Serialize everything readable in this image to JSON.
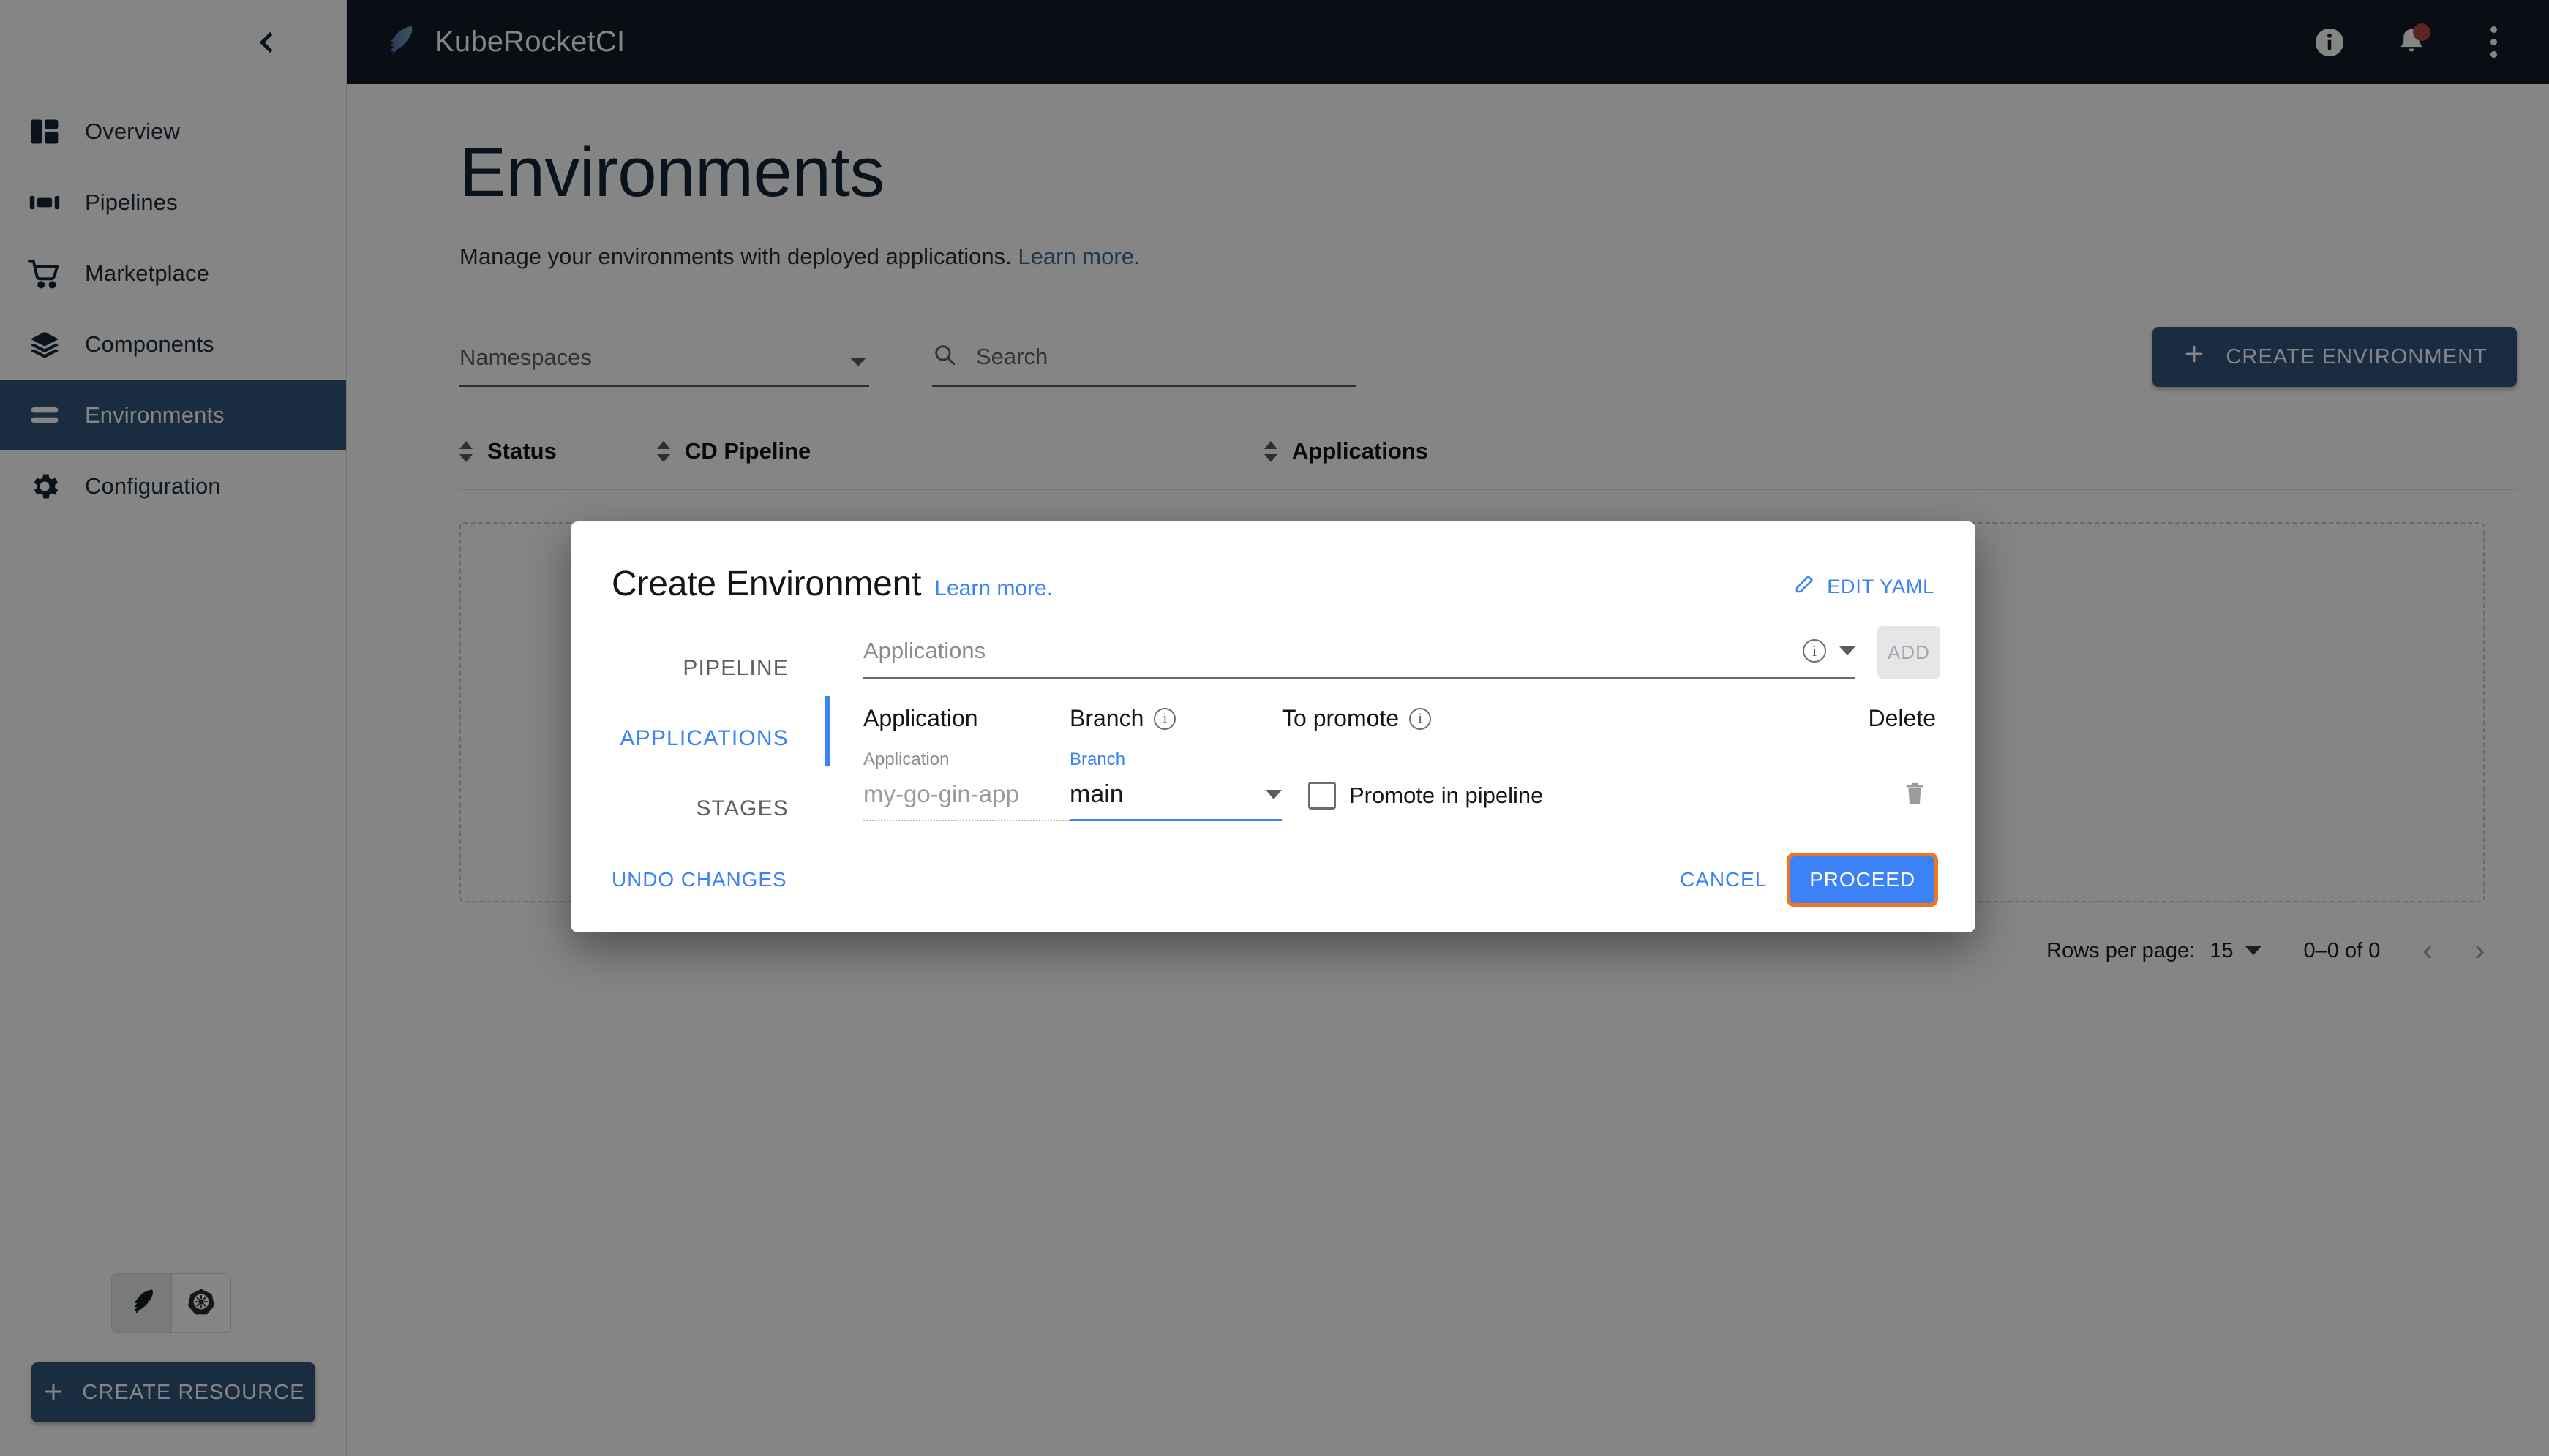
{
  "sidebar": {
    "collapse_icon": "chevron-left-icon",
    "items": [
      {
        "label": "Overview",
        "icon": "dashboard-icon",
        "active": false
      },
      {
        "label": "Pipelines",
        "icon": "pipelines-icon",
        "active": false
      },
      {
        "label": "Marketplace",
        "icon": "cart-icon",
        "active": false
      },
      {
        "label": "Components",
        "icon": "layers-icon",
        "active": false
      },
      {
        "label": "Environments",
        "icon": "environments-icon",
        "active": true
      },
      {
        "label": "Configuration",
        "icon": "gear-icon",
        "active": false
      }
    ],
    "logo_toggle": {
      "left_icon": "kuberocket-feather-icon",
      "right_icon": "kubernetes-helm-icon"
    },
    "create_resource_label": "CREATE RESOURCE",
    "create_resource_icon": "plus-icon"
  },
  "topbar": {
    "brand_name": "KubeRocketCI",
    "brand_icon": "kuberocket-feather-icon",
    "info_icon": "info-circle-icon",
    "notifications_icon": "bell-icon",
    "notifications_badge": true,
    "more_icon": "kebab-menu-icon"
  },
  "page": {
    "title": "Environments",
    "subtitle": "Manage your environments with deployed applications.",
    "subtitle_link": "Learn more."
  },
  "filters": {
    "namespaces_placeholder": "Namespaces",
    "namespaces_value": "",
    "search_placeholder": "Search",
    "search_value": "",
    "search_icon": "search-icon",
    "create_environment_label": "CREATE ENVIRONMENT",
    "create_environment_icon": "plus-icon"
  },
  "table": {
    "columns": [
      {
        "label": "Status",
        "sortable": true
      },
      {
        "label": "CD Pipeline",
        "sortable": true
      },
      {
        "label": "Applications",
        "sortable": true
      }
    ],
    "rows": []
  },
  "pagination": {
    "rows_per_page_label": "Rows per page:",
    "rows_per_page_value": "15",
    "range_label": "0–0 of 0",
    "prev_icon": "chevron-left-icon",
    "next_icon": "chevron-right-icon"
  },
  "modal": {
    "title": "Create Environment",
    "title_link": "Learn more.",
    "edit_yaml_label": "EDIT YAML",
    "edit_yaml_icon": "pencil-icon",
    "steps": [
      {
        "label": "PIPELINE",
        "active": false
      },
      {
        "label": "APPLICATIONS",
        "active": true
      },
      {
        "label": "STAGES",
        "active": false
      }
    ],
    "applications_field": {
      "placeholder": "Applications",
      "value": "",
      "info_icon": "info-circle-icon",
      "dropdown_icon": "caret-down-icon",
      "add_label": "ADD",
      "add_disabled": true
    },
    "app_table": {
      "headers": {
        "application": "Application",
        "branch": "Branch",
        "branch_info_icon": "info-circle-icon",
        "to_promote": "To promote",
        "to_promote_info_icon": "info-circle-icon",
        "delete": "Delete"
      },
      "rows": [
        {
          "application_label": "Application",
          "application_value": "my-go-gin-app",
          "branch_label": "Branch",
          "branch_value": "main",
          "promote_label": "Promote in pipeline",
          "promote_checked": false,
          "delete_icon": "trash-icon"
        }
      ]
    },
    "footer": {
      "undo_label": "UNDO CHANGES",
      "cancel_label": "CANCEL",
      "proceed_label": "PROCEED",
      "proceed_highlight_color": "#ef7622"
    }
  },
  "colors": {
    "brand_dark": "#0b1b30",
    "primary": "#1f5796",
    "accent_blue": "#3b82f6",
    "highlight_orange": "#ef7622",
    "notification_red": "#e2393c"
  }
}
